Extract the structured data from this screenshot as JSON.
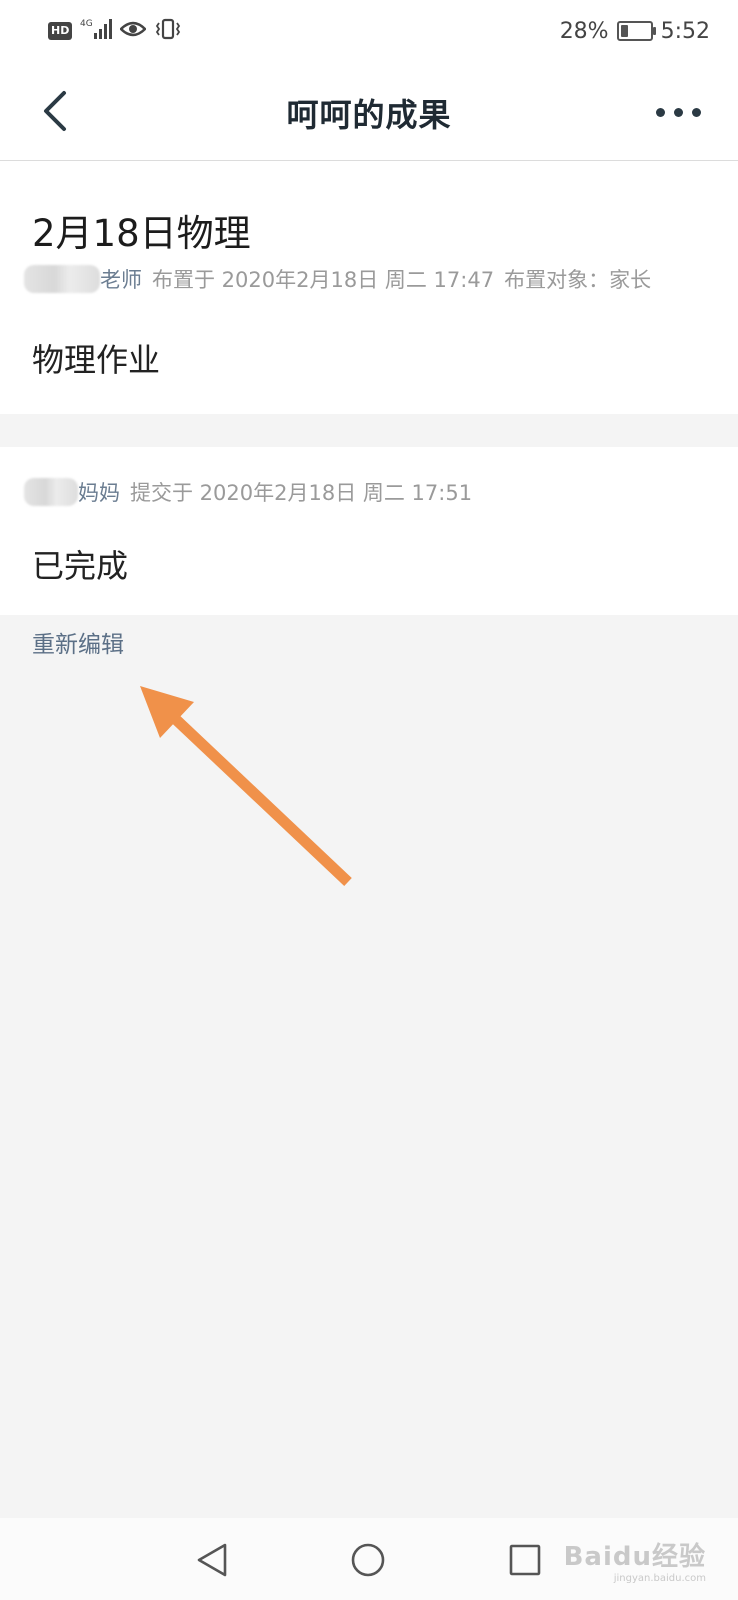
{
  "status_bar": {
    "hd_badge": "HD",
    "network": "4G",
    "battery_percent": "28%",
    "battery_level": 0.28,
    "time": "5:52",
    "icons": [
      "hd-icon",
      "signal-icon",
      "eye-icon",
      "vibrate-icon",
      "battery-icon"
    ]
  },
  "nav": {
    "title": "呵呵的成果",
    "back_icon": "chevron-left-icon",
    "more_icon": "more-dots-icon"
  },
  "assignment": {
    "title": "2月18日物理",
    "teacher_suffix": "老师",
    "assigned_text": "布置于 2020年2月18日 周二 17:47",
    "target_text": "布置对象：家长",
    "content": "物理作业"
  },
  "submission": {
    "submitter_suffix": "妈妈",
    "submitted_text": "提交于 2020年2月18日 周二 17:51",
    "content": "已完成"
  },
  "actions": {
    "reedit_label": "重新编辑"
  },
  "colors": {
    "accent_link": "#5b6f86",
    "annotation_arrow": "#f0914a",
    "background": "#f4f4f4"
  },
  "watermark": {
    "brand": "Baidu经验",
    "url": "jingyan.baidu.com"
  }
}
